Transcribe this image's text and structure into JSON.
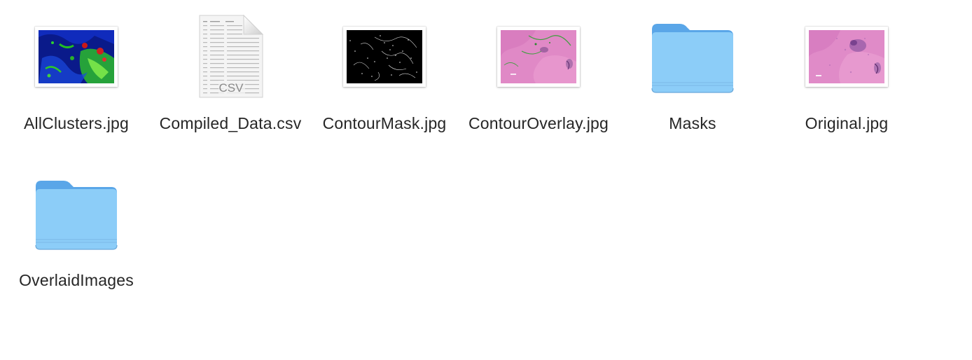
{
  "files": [
    {
      "label": "AllClusters.jpg",
      "kind": "image",
      "icon": "image-thumbnail-icon"
    },
    {
      "label": "Compiled_Data.csv",
      "kind": "document",
      "icon": "csv-document-icon",
      "badge": "CSV"
    },
    {
      "label": "ContourMask.jpg",
      "kind": "image",
      "icon": "image-thumbnail-icon"
    },
    {
      "label": "ContourOverlay.jpg",
      "kind": "image",
      "icon": "image-thumbnail-icon"
    },
    {
      "label": "Masks",
      "kind": "folder",
      "icon": "folder-icon"
    },
    {
      "label": "Original.jpg",
      "kind": "image",
      "icon": "image-thumbnail-icon"
    },
    {
      "label": "OverlaidImages",
      "kind": "folder",
      "icon": "folder-icon"
    }
  ],
  "colors": {
    "folder_body": "#8ccdf8",
    "folder_tab": "#5aa6e8",
    "label_text": "#262626"
  }
}
